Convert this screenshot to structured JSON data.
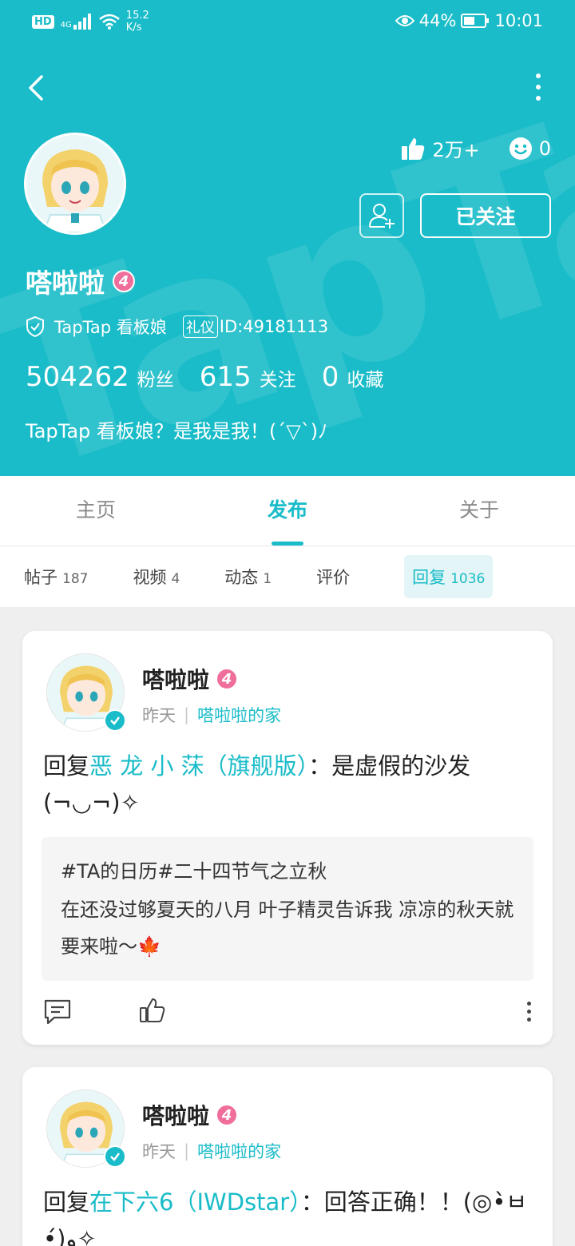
{
  "status_bar": {
    "hd": "HD",
    "network": "4G",
    "speed_value": "15.2",
    "speed_unit": "K/s",
    "battery": "44%",
    "time": "10:01"
  },
  "profile": {
    "likes": "2万+",
    "emoji_count": "0",
    "followed_label": "已关注",
    "name": "嗒啦啦",
    "level": "4",
    "verify_text": "TapTap 看板娘",
    "liyi_tag": "礼仪",
    "id_text": "ID:49181113",
    "fans_num": "504262",
    "fans_label": "粉丝",
    "following_num": "615",
    "following_label": "关注",
    "fav_num": "0",
    "fav_label": "收藏",
    "bio": "TapTap 看板娘？是我是我！(´▽`)ﾉ"
  },
  "main_tabs": [
    {
      "label": "主页"
    },
    {
      "label": "发布"
    },
    {
      "label": "关于"
    }
  ],
  "sub_tabs": [
    {
      "label": "帖子",
      "count": "187"
    },
    {
      "label": "视频",
      "count": "4"
    },
    {
      "label": "动态",
      "count": "1"
    },
    {
      "label": "评价",
      "count": ""
    },
    {
      "label": "回复",
      "count": "1036"
    }
  ],
  "posts": [
    {
      "author": "嗒啦啦",
      "level": "4",
      "time": "昨天",
      "group": "嗒啦啦的家",
      "prefix": "回复",
      "mention": "恶 龙 小 莯（旗舰版）",
      "text": "：是虚假的沙发(¬◡¬)✧",
      "quote_title": "#TA的日历#二十四节气之立秋",
      "quote_body": "在还没过够夏天的八月 叶子精灵告诉我 凉凉的秋天就要来啦～🍁"
    },
    {
      "author": "嗒啦啦",
      "level": "4",
      "time": "昨天",
      "group": "嗒啦啦的家",
      "prefix": "回复",
      "mention": "在下六6（IWDstar）",
      "text": "：回答正确！！(◎•̀ㅂ•́)و✧"
    }
  ],
  "colors": {
    "accent": "#19bcc8",
    "level_badge": "#f06e9b"
  }
}
